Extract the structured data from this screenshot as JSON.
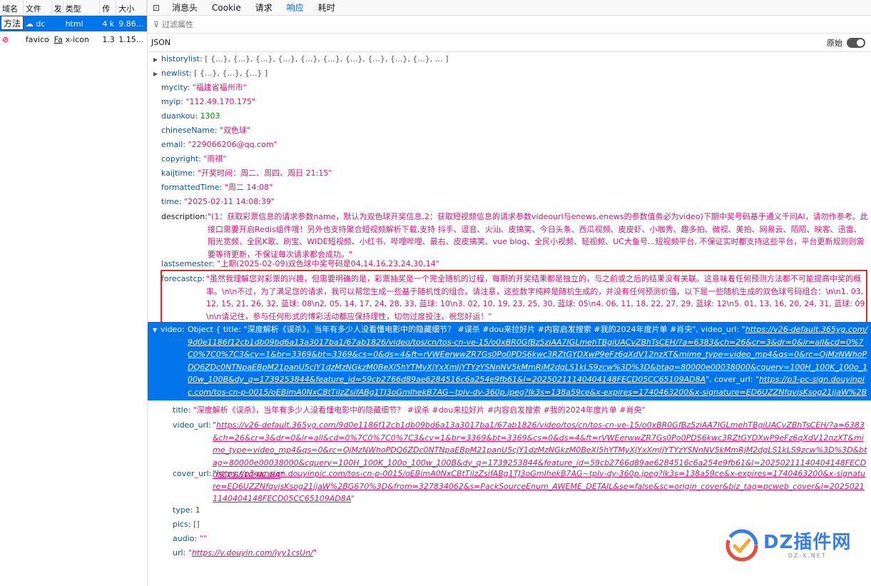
{
  "left": {
    "columns": [
      "域名",
      "文件",
      "发",
      "类型",
      "传",
      "大小"
    ],
    "method_tooltip": "方法",
    "rows": [
      {
        "domain": "in",
        "file": "dc",
        "cause": "",
        "type": "html",
        "transfer": "4 k",
        "size": "9.86..."
      },
      {
        "domain": "",
        "file": "favico",
        "cause": "Fa",
        "type": "x-icon",
        "transfer": "1.3",
        "size": "1.15..."
      }
    ]
  },
  "tabs": [
    "消息头",
    "Cookie",
    "请求",
    "响应",
    "耗时"
  ],
  "active_tab": "响应",
  "filter_placeholder": "过滤属性",
  "json_label": "JSON",
  "raw_label": "原始",
  "tree": {
    "historylist": {
      "key": "historylist:",
      "value": "[ {...}, {...}, {...}, {...}, {...}, {...}, {...}, {...}, {...}, {...}, … ]"
    },
    "newlist": {
      "key": "newlist:",
      "value": "[ {...}, {...}, {...} ]"
    },
    "mycity": {
      "key": "mycity:",
      "value": "\"福建省福州市\""
    },
    "myip": {
      "key": "myip:",
      "value": "\"112.49.170.175\""
    },
    "duankou": {
      "key": "duankou:",
      "value": "1303"
    },
    "chineseName": {
      "key": "chineseName:",
      "value": "\"双色球\""
    },
    "email": {
      "key": "email:",
      "value": "\"229066206@qq.com\""
    },
    "copyright": {
      "key": "copyright:",
      "value": "\"雨祺\""
    },
    "kaijtime": {
      "key": "kaijtime:",
      "value": "\"开奖时间：周二、周四、周日 21:15\""
    },
    "formattedTime": {
      "key": "formattedTime:",
      "value": "\"周二 14:08\""
    },
    "time": {
      "key": "time:",
      "value": "\"2025-02-11 14:08:39\""
    },
    "description": {
      "key": "description:",
      "value": "\"(1：获取彩票信息的请求参数name，默认为双色球开奖信息,2：获取短视频信息的请求参数videourl与enews,enews的参数值务必为video)下期中奖号码基于通义千问AI，请勿作参考。此接口需要开启Redis组件哦！另外也支持聚合短视频解析下载,支持 抖手、逗音、火汕、皮搞笑、今日头条、西瓜视频、皮皮虾、小咖秀、趣多拍、微视、美拍、网易云、陌陌、映客、迅雷、阳光宽频、全民K歌、刷宝、WIDE短视频、小红书、哔哩哔哩、最右、皮皮搞笑、vue blog、全民小视频、轻视频、UC大鱼号...短视频平台, 不保证实时都支持这些平台，平台更新规则则需要等待更新，不保证每次请求都会成功。\""
    },
    "lastsemester": {
      "key": "lastsemester:",
      "value": "\"上期(2025-02-09)双色球中奖号码是04,14,16,23,24,30,14\""
    },
    "forecastcp": {
      "key": "forecastcp:",
      "value": "\"虽然我理解您对彩票的兴趣，但需要明确的是，彩票抽奖是一个完全随机的过程，每期的开奖结果都是独立的，与之前或之后的结果没有关联。这意味着任何预测方法都不可能提高中奖的概率。\\n\\n不过，为了满足您的请求，我可以帮您生成一些基于随机性的组合。请注意，这些数字纯粹是随机生成的，并没有任何预测价值。以下是一些随机生成的双色球号码组合：\\n\\n1. 03, 12, 15, 21, 26, 32, 蓝球: 08\\n2. 05, 14, 17, 24, 28, 33, 蓝球: 10\\n3. 02, 10, 19, 23, 25, 30, 蓝球: 05\\n4. 06, 11, 18, 22, 27, 29, 蓝球: 12\\n5. 01, 13, 16, 20, 24, 31, 蓝球: 09\\n\\n请记住，参与任何形式的博彩活动都应保持理性，切勿过度投注。祝您好运！\""
    },
    "video_summary": {
      "key": "video:",
      "prefix": "Object { title: \"深度解析《误杀》，当年有多少人没看懂电影中的隐藏细节？ #误杀 #dou来拉好片 #内容启发搜索 #我的2024年度片单 #肖央\", video_url: \"",
      "video_url": "https://v26-default.365yg.com/9d0e1186f12cb1db09bd6a13a3017ba1/67ab1826/video/tos/cn/tos-cn-ve-15/o0xBR0GfBz5ziAA7IGLmehTBgiUACvZBhTsCEH/?a=6383&ch=26&cr=3&dr=0&lr=all&cd=0%7C0%7C0%7C3&cv=1&br=3369&bt=3369&cs=0&ds=4&ft=rVWEerwwZR7Gs0Po0PDS6kwc3RZtGYDXwP9eFz6qXdV12nzXT&mime_type=video_mp4&qs=0&rc=OjMzNWhoPDQ6ZDc0NTNpaEBpM21panU5cjY1dzMzNGkzM0BeXl5hYTMyXjYxXmJjYTYzYSNnNV5kMmRjM2dgLS1kLS9zcw%3D%3D&btag=80000e00038000&cquery=100H_100K_100o_100w_100B&dy_q=1739253844&feature_id=59cb2766d89ae6284516c6a254e9fb61&l=20250211140404148FECD05CC65109AD8A",
      "mid": "\", cover_url: \"",
      "cover_url": "https://p3-pc-sign.douyinpic.com/tos-cn-p-0015/oEBimA0NxCBtTilzZsifABg1TJ3oGmIhekB7AG~tplv-dy-360p.jpeg?lk3s=138a59ce&x-expires=1740463200&x-signature=ED6UZZNfqvjsKsog21jjaW%2BG670%3D&from=327834062&s=PackSourceEnum_AWEME_DETAIL&se=false&sc=origin_cover&biz_tag=pcweb_cover&l=20250211140404148FECD05CC65109AD8A",
      "suffix": "\", … }"
    },
    "video_title": {
      "key": "title:",
      "value": "\"深度解析《误杀》，当年有多少人没看懂电影中的隐藏细节？ #误杀 #dou来拉好片 #内容启发搜索 #我的2024年度片单 #肖央\""
    },
    "video_url_key": "video_url:",
    "cover_url_key": "cover_url:",
    "type": {
      "key": "type:",
      "value": "1"
    },
    "pics": {
      "key": "pics:",
      "value": "[]"
    },
    "audio": {
      "key": "audio:",
      "value": "\"\""
    },
    "url": {
      "key": "url:",
      "link": "https://v.douyin.com/iyy1csUn/"
    }
  },
  "watermark": {
    "text": "DZ插件网",
    "sub": "DZ-X.NET"
  }
}
